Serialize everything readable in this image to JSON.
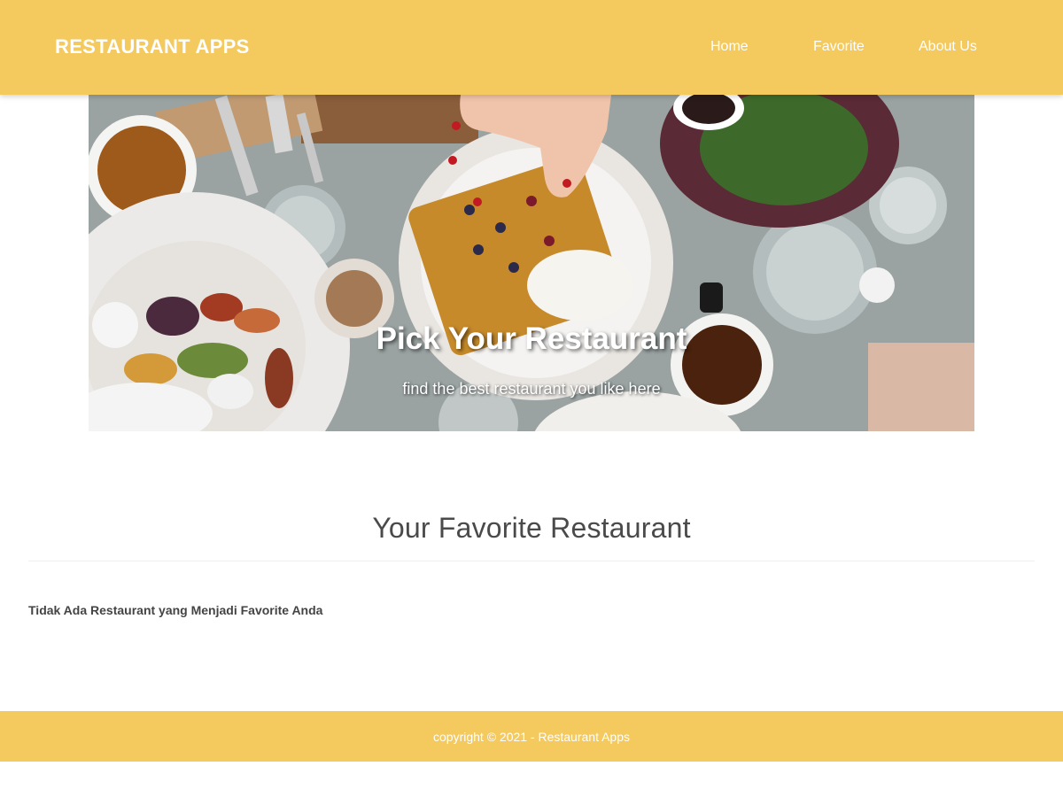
{
  "header": {
    "brand": "RESTAURANT APPS",
    "nav": [
      {
        "label": "Home"
      },
      {
        "label": "Favorite"
      },
      {
        "label": "About Us"
      }
    ]
  },
  "hero": {
    "title": "Pick Your Restaurant",
    "subtitle": "find the best restaurant you like here"
  },
  "main": {
    "section_title": "Your Favorite Restaurant",
    "empty_message": "Tidak Ada Restaurant yang Menjadi Favorite Anda"
  },
  "footer": {
    "copyright": "copyright © 2021 - Restaurant Apps"
  },
  "colors": {
    "accent": "#f4c95d",
    "header_text": "#ffffff",
    "body_text": "#444444"
  }
}
